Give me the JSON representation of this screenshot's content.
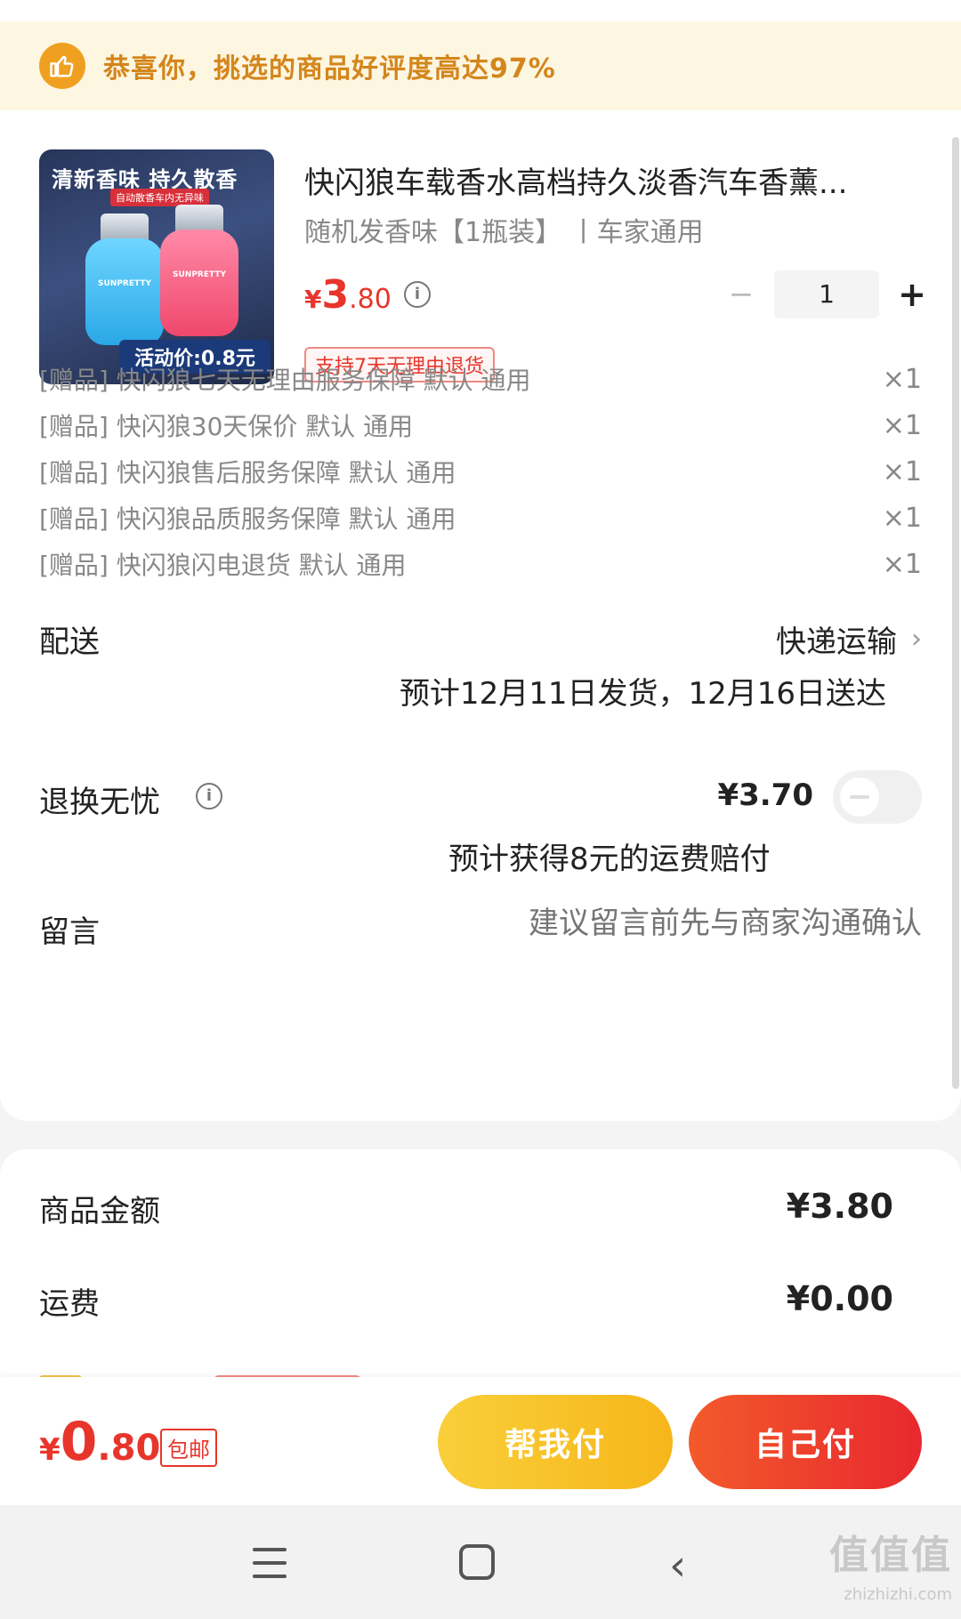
{
  "banner": {
    "text": "恭喜你，挑选的商品好评度高达97%"
  },
  "product": {
    "image": {
      "headline": "清新香味 持久散香",
      "subline": "自动散香车内无异味",
      "brand": "SUNPRETTY",
      "promo": "活动价:0.8元"
    },
    "title": "快闪狼车载香水高档持久淡香汽车香薰...",
    "spec": "随机发香味【1瓶装】 丨车家通用",
    "price": {
      "currency": "¥",
      "integer": "3",
      "decimal": ".80"
    },
    "quantity": "1",
    "return_tag": "支持7天无理由退货"
  },
  "gifts": [
    {
      "label": "[赠品] 快闪狼七天无理由服务保障 默认 通用",
      "count": "×1"
    },
    {
      "label": "[赠品] 快闪狼30天保价 默认 通用",
      "count": "×1"
    },
    {
      "label": "[赠品] 快闪狼售后服务保障 默认 通用",
      "count": "×1"
    },
    {
      "label": "[赠品] 快闪狼品质服务保障 默认 通用",
      "count": "×1"
    },
    {
      "label": "[赠品] 快闪狼闪电退货 默认 通用",
      "count": "×1"
    }
  ],
  "delivery": {
    "label": "配送",
    "method": "快递运输",
    "estimate": "预计12月11日发货，12月16日送达"
  },
  "worry_free": {
    "label": "退换无忧",
    "price": "¥3.70",
    "note": "预计获得8元的运费赔付",
    "enabled": false
  },
  "message": {
    "label": "留言",
    "placeholder": "建议留言前先与商家沟通确认"
  },
  "amounts": {
    "goods_label": "商品金额",
    "goods_value": "¥3.80",
    "shipping_label": "运费",
    "shipping_value": "¥0.00"
  },
  "checkout": {
    "total": {
      "currency": "¥",
      "integer": "0",
      "decimal": ".80"
    },
    "free_shipping": "包邮",
    "help_pay": "帮我付",
    "self_pay": "自己付"
  },
  "watermark": {
    "text": "值值值",
    "url": "zhizhizhi.com"
  },
  "colors": {
    "accent": "#e8352b",
    "banner_text": "#d4861c",
    "help_btn": "#f6b61a"
  }
}
